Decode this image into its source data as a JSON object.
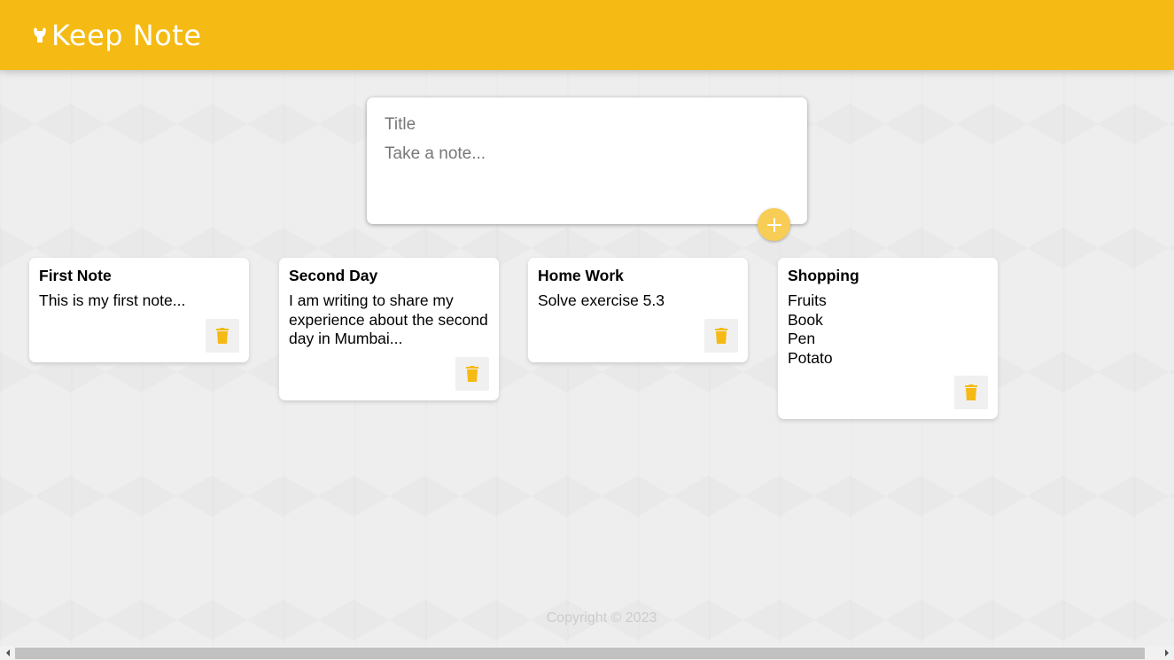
{
  "header": {
    "title": "Keep Note",
    "logo_icon": "highlighter-icon",
    "color": "#f5ba13"
  },
  "create_note": {
    "title_placeholder": "Title",
    "content_placeholder": "Take a note...",
    "add_icon": "plus-icon",
    "add_button_color": "#f8cd55"
  },
  "notes": [
    {
      "title": "First Note",
      "content": "This is my first note..."
    },
    {
      "title": "Second Day",
      "content": "I am writing to share my experience about the second day in Mumbai..."
    },
    {
      "title": "Home Work",
      "content": "Solve exercise 5.3"
    },
    {
      "title": "Shopping",
      "content": "Fruits\nBook\nPen\nPotato"
    }
  ],
  "delete_icon": "trash-icon",
  "accent_color": "#f5ba13",
  "footer": {
    "copyright": "Copyright © 2023"
  }
}
